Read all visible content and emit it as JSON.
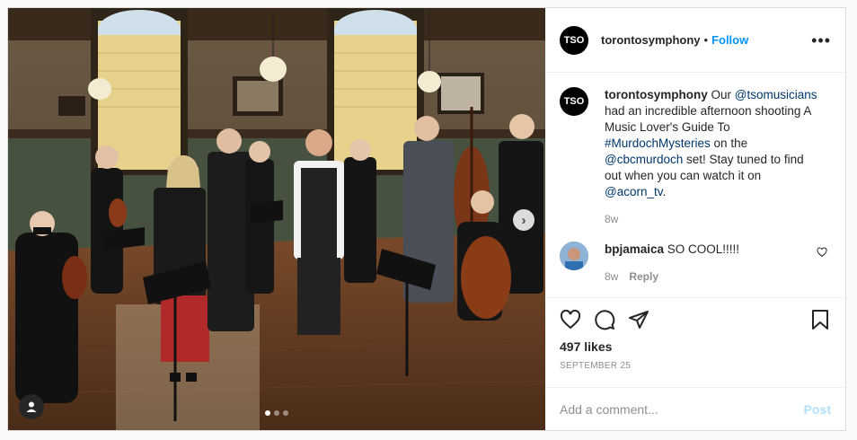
{
  "header": {
    "avatar_text": "TSO",
    "username": "torontosymphony",
    "separator": "•",
    "follow_label": "Follow",
    "more_label": "•••"
  },
  "caption": {
    "username": "torontosymphony",
    "text_1": " Our ",
    "mention_1": "@tsomusicians",
    "text_2": " had an incredible afternoon shooting A Music Lover's Guide To ",
    "hashtag": "#MurdochMysteries",
    "text_3": " on the ",
    "mention_2": "@cbcmurdoch",
    "text_4": " set! Stay tuned to find out when you can watch it on ",
    "mention_3": "@acorn_tv",
    "text_5": ".",
    "time": "8w"
  },
  "reply": {
    "username": "bpjamaica",
    "text": " SO COOL!!!!!",
    "time": "8w",
    "reply_label": "Reply"
  },
  "engagement": {
    "likes": "497 likes",
    "date": "SEPTEMBER 25"
  },
  "comment_box": {
    "placeholder": "Add a comment...",
    "post_label": "Post"
  },
  "carousel": {
    "next_label": "›",
    "slides": 3,
    "active_slide": 1
  },
  "icons": {
    "like": "heart-icon",
    "comment": "comment-icon",
    "share": "paper-plane-icon",
    "save": "bookmark-icon",
    "tagged": "user-tag-icon"
  },
  "colors": {
    "accent": "#0095f6",
    "link": "#00376b",
    "muted": "#8e8e8e",
    "post_disabled": "#b2dffc"
  }
}
